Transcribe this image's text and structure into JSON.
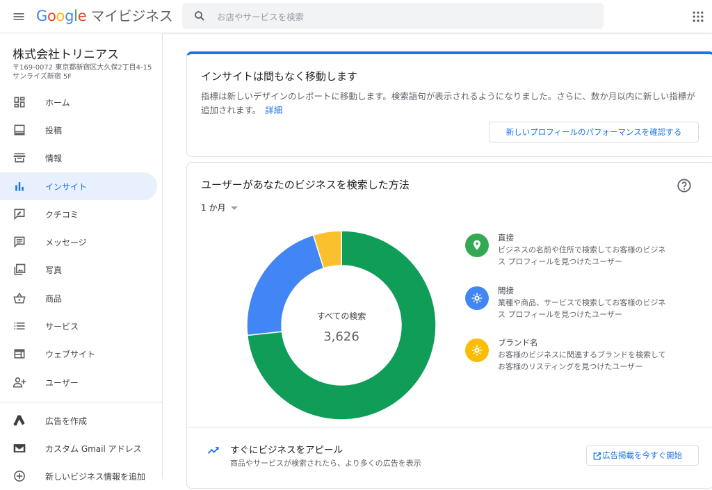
{
  "header": {
    "menu_icon": "menu-icon",
    "logo_letters": [
      "G",
      "o",
      "o",
      "g",
      "l",
      "e"
    ],
    "product": "マイビジネス",
    "search": {
      "placeholder": "お店やサービスを検索",
      "value": ""
    },
    "apps_icon": "apps-grid-icon"
  },
  "sidebar": {
    "business_name": "株式会社トリニアス",
    "address_line1": "〒169-0072 東京都新宿区大久保2丁目4-15",
    "address_line2": "サンライズ新宿 5F",
    "items": [
      {
        "label": "ホーム",
        "icon": "dashboard-icon"
      },
      {
        "label": "投稿",
        "icon": "posts-icon"
      },
      {
        "label": "情報",
        "icon": "storefront-icon"
      },
      {
        "label": "インサイト",
        "icon": "bar-chart-icon",
        "active": true
      },
      {
        "label": "クチコミ",
        "icon": "review-icon"
      },
      {
        "label": "メッセージ",
        "icon": "message-icon"
      },
      {
        "label": "写真",
        "icon": "photo-icon"
      },
      {
        "label": "商品",
        "icon": "basket-icon"
      },
      {
        "label": "サービス",
        "icon": "list-icon"
      },
      {
        "label": "ウェブサイト",
        "icon": "web-icon"
      },
      {
        "label": "ユーザー",
        "icon": "add-user-icon"
      }
    ],
    "bottom_items": [
      {
        "label": "広告を作成",
        "icon": "google-ads-icon"
      },
      {
        "label": "カスタム Gmail アドレス",
        "icon": "gmail-icon"
      },
      {
        "label": "新しいビジネス情報を追加",
        "icon": "add-circle-icon"
      }
    ]
  },
  "notice": {
    "title": "インサイトは間もなく移動します",
    "body": "指標は新しいデザインのレポートに移動します。検索語句が表示されるようになりました。さらに、数か月以内に新しい指標が追加されます。",
    "link": "詳細",
    "button": "新しいプロフィールのパフォーマンスを確認する"
  },
  "search_card": {
    "title": "ユーザーがあなたのビジネスを検索した方法",
    "help_icon": "help-icon",
    "period": "1 か月",
    "center_label": "すべての検索",
    "center_value": "3,626",
    "legend": [
      {
        "title": "直接",
        "desc": "ビジネスの名前や住所で検索してお客様のビジネス プロフィールを見つけたユーザー",
        "color": "#34a853",
        "icon": "location-pin-icon"
      },
      {
        "title": "間接",
        "desc": "業種や商品、サービスで検索してお客様のビジネス プロフィールを見つけたユーザー",
        "color": "#4285f4",
        "icon": "compass-icon"
      },
      {
        "title": "ブランド名",
        "desc": "お客様のビジネスに関連するブランドを検索してお客様のリスティングを見つけたユーザー",
        "color": "#fbbc04",
        "icon": "badge-icon"
      }
    ],
    "promo": {
      "title": "すぐにビジネスをアピール",
      "subtitle": "商品やサービスが検索されたら、より多くの広告を表示",
      "button": "広告掲載を今すぐ開始",
      "icon": "trending-up-icon"
    }
  },
  "chart_data": {
    "type": "pie",
    "title": "ユーザーがあなたのビジネスを検索した方法",
    "total_label": "すべての検索",
    "total": 3626,
    "categories": [
      "直接",
      "間接",
      "ブランド名"
    ],
    "values": [
      2658,
      794,
      174
    ],
    "colors": [
      "#0f9d58",
      "#4285f4",
      "#fbc02d"
    ]
  }
}
